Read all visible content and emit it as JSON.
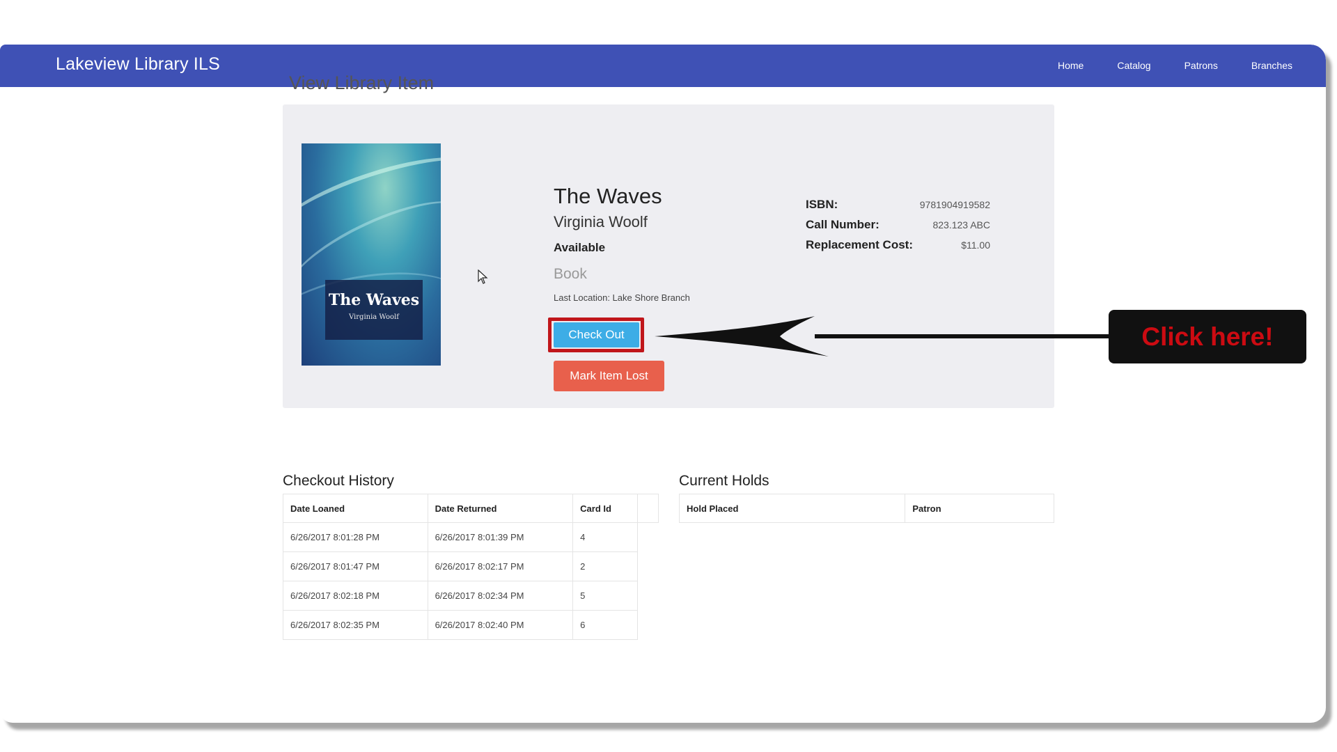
{
  "app": {
    "brand": "Lakeview Library ILS",
    "nav": [
      "Home",
      "Catalog",
      "Patrons",
      "Branches"
    ]
  },
  "page": {
    "title": "View Library Item"
  },
  "item": {
    "cover_title": "The Waves",
    "cover_author": "Virginia Woolf",
    "title": "The Waves",
    "author": "Virginia Woolf",
    "status": "Available",
    "type": "Book",
    "last_location": "Last Location: Lake Shore Branch",
    "checkout_label": "Check Out",
    "lost_label": "Mark Item Lost",
    "details": [
      {
        "label": "ISBN:",
        "value": "9781904919582"
      },
      {
        "label": "Call Number:",
        "value": "823.123 ABC"
      },
      {
        "label": "Replacement Cost:",
        "value": "$11.00"
      }
    ]
  },
  "annotation": {
    "text": "Click here!"
  },
  "history": {
    "title": "Checkout History",
    "headers": [
      "Date Loaned",
      "Date Returned",
      "Card Id"
    ],
    "rows": [
      [
        "6/26/2017 8:01:28 PM",
        "6/26/2017 8:01:39 PM",
        "4"
      ],
      [
        "6/26/2017 8:01:47 PM",
        "6/26/2017 8:02:17 PM",
        "2"
      ],
      [
        "6/26/2017 8:02:18 PM",
        "6/26/2017 8:02:34 PM",
        "5"
      ],
      [
        "6/26/2017 8:02:35 PM",
        "6/26/2017 8:02:40 PM",
        "6"
      ]
    ]
  },
  "holds": {
    "title": "Current Holds",
    "headers": [
      "Hold Placed",
      "Patron"
    ]
  },
  "colors": {
    "navbar": "#3f51b5",
    "checkout_button": "#3dade6",
    "lost_button": "#e8604c",
    "annotation_text": "#cc0b12",
    "highlight_border": "#c0161b"
  }
}
